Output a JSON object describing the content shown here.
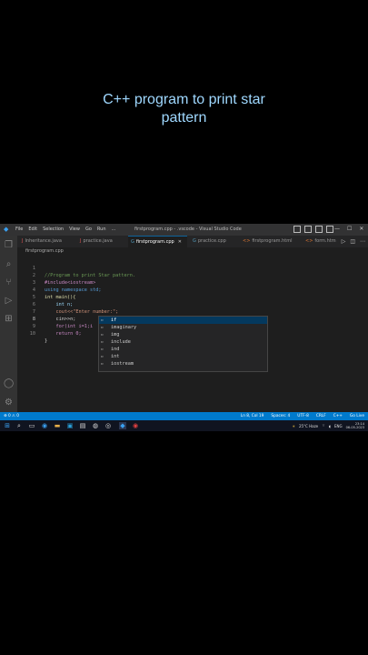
{
  "caption": {
    "line1": "C++ program to print star",
    "line2": "pattern"
  },
  "titlebar": {
    "menu": [
      "File",
      "Edit",
      "Selection",
      "View",
      "Go",
      "Run",
      "..."
    ],
    "title": "firstprogram.cpp - .vscode - Visual Studio Code",
    "window_controls": [
      "—",
      "☐",
      "✕"
    ]
  },
  "tabs": [
    {
      "label": "Inheritance.java",
      "icon": "J",
      "color": "#e05252"
    },
    {
      "label": "practice.java",
      "icon": "J",
      "color": "#e05252"
    },
    {
      "label": "firstprogram.cpp",
      "icon": "G",
      "color": "#519aba",
      "active": true,
      "close": "✕"
    },
    {
      "label": "practice.cpp",
      "icon": "G",
      "color": "#519aba"
    },
    {
      "label": "firstprogram.html",
      "icon": "<>",
      "color": "#e37933"
    },
    {
      "label": "form.htm",
      "icon": "<>",
      "color": "#e37933"
    }
  ],
  "breadcrumb": "firstprogram.cpp",
  "code": [
    {
      "n": "1",
      "text": "//Program to print Star pattern."
    },
    {
      "n": "2",
      "text": "#include<iostream>"
    },
    {
      "n": "3",
      "text": "using namespace std;"
    },
    {
      "n": "4",
      "text": "int main(){"
    },
    {
      "n": "5",
      "text": "    int n;"
    },
    {
      "n": "6",
      "text": "    cout<<\"Enter number:\";"
    },
    {
      "n": "7",
      "text": "    cin>>n;"
    },
    {
      "n": "8",
      "text": "    for(int i=1;i"
    },
    {
      "n": "9",
      "text": "    return 0;"
    },
    {
      "n": "10",
      "text": "}"
    }
  ],
  "suggestions": [
    "if",
    "imaginary",
    "img",
    "include",
    "ind",
    "int",
    "iostream"
  ],
  "statusbar": {
    "left": "⊗ 0 ⚠ 0",
    "right": [
      "Ln 8, Col 19",
      "Spaces: 4",
      "UTF-8",
      "CRLF",
      "C++",
      "Go Live"
    ]
  },
  "taskbar": {
    "weather": "25°C Haze",
    "lang": "ENG",
    "time": "23:14",
    "date": "06-05-2023"
  },
  "colors": {
    "accent": "#007acc",
    "caption": "#9fd8ff"
  }
}
